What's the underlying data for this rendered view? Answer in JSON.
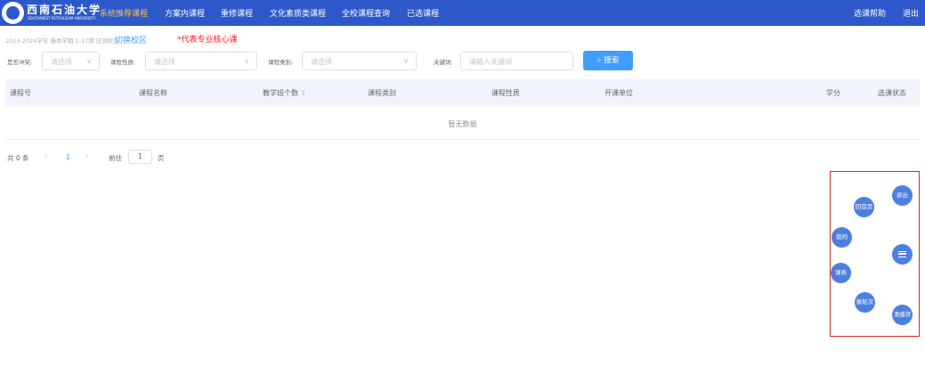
{
  "header": {
    "logo_text": "西南石油大学",
    "logo_subtext": "SOUTHWEST PETROLEUM UNIVERSITY",
    "nav": [
      {
        "label": "系统推荐课程",
        "active": true
      },
      {
        "label": "方案内课程",
        "active": false
      },
      {
        "label": "重修课程",
        "active": false
      },
      {
        "label": "文化素质类课程",
        "active": false
      },
      {
        "label": "全校课程查询",
        "active": false
      },
      {
        "label": "已选课程",
        "active": false
      }
    ],
    "help": "选课帮助",
    "logout": "退出"
  },
  "term_info": "2023-2024学年 春季学期 1-17周 压测校区",
  "switch_campus": "切换校区",
  "core_note": "*代表专业核心课",
  "filters": {
    "conflict": {
      "label": "是否冲突:",
      "placeholder": "请选择"
    },
    "nature": {
      "label": "课程性质:",
      "placeholder": "请选择"
    },
    "category": {
      "label": "课程类别:",
      "placeholder": "请选择"
    },
    "keyword": {
      "label": "关键词:",
      "placeholder": "请输入关键词"
    },
    "search_button": "搜索"
  },
  "table": {
    "columns": [
      "课程号",
      "课程名称",
      "教学班个数",
      "课程类别",
      "课程性质",
      "开课单位",
      "学分",
      "选课状态"
    ],
    "sort_icon": "⇕",
    "empty_text": "暂无数据"
  },
  "pagination": {
    "total": "共 0 条",
    "current_page": "1",
    "goto_prefix": "前往",
    "goto_value": "1",
    "goto_suffix": "页"
  },
  "floating_menu": {
    "exit": "退出",
    "home": "回首页",
    "mine": "我的",
    "menu_icon": "menu-icon",
    "schedule": "课表",
    "change_round": "换轮次",
    "clear_cache": "清缓存"
  },
  "colors": {
    "header_bg": "#2d58c9",
    "active_nav": "#f7c24a",
    "accent": "#409eff",
    "core_note": "#ff1a1a",
    "fab": "#4d7fe0",
    "highlight_box": "#e0251c"
  }
}
